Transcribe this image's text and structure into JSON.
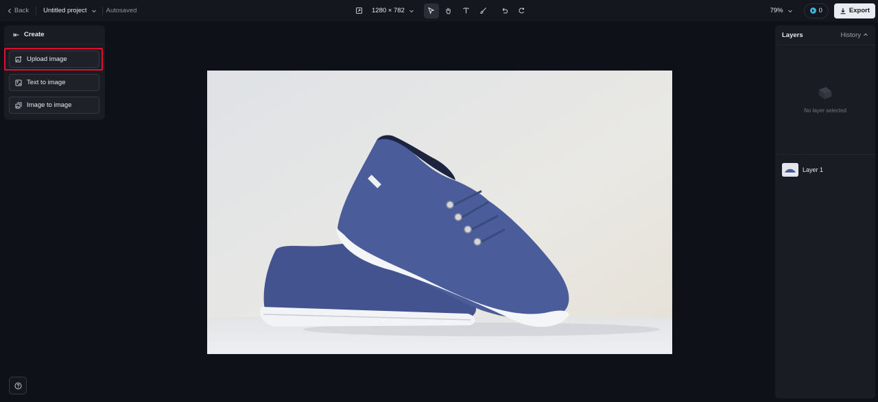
{
  "topbar": {
    "back_label": "Back",
    "project_name": "Untitled project",
    "autosave_status": "Autosaved",
    "canvas_size": "1280 × 782",
    "zoom": "79%",
    "credits": "0",
    "export_label": "Export"
  },
  "create_panel": {
    "title": "Create",
    "items": [
      {
        "label": "Upload image",
        "icon": "upload-image-icon"
      },
      {
        "label": "Text to image",
        "icon": "text-to-image-icon"
      },
      {
        "label": "Image to image",
        "icon": "image-to-image-icon"
      }
    ]
  },
  "layers_panel": {
    "title": "Layers",
    "history_label": "History",
    "empty_text": "No layer selected",
    "layers": [
      {
        "name": "Layer 1"
      }
    ]
  },
  "canvas": {
    "image_description_icon": "shoe-image"
  },
  "colors": {
    "background": "#0e1117",
    "panel": "#191c22",
    "highlight": "#e0102a",
    "export_bg": "#e9edf2",
    "credit_accent": "#3bb3e6"
  }
}
